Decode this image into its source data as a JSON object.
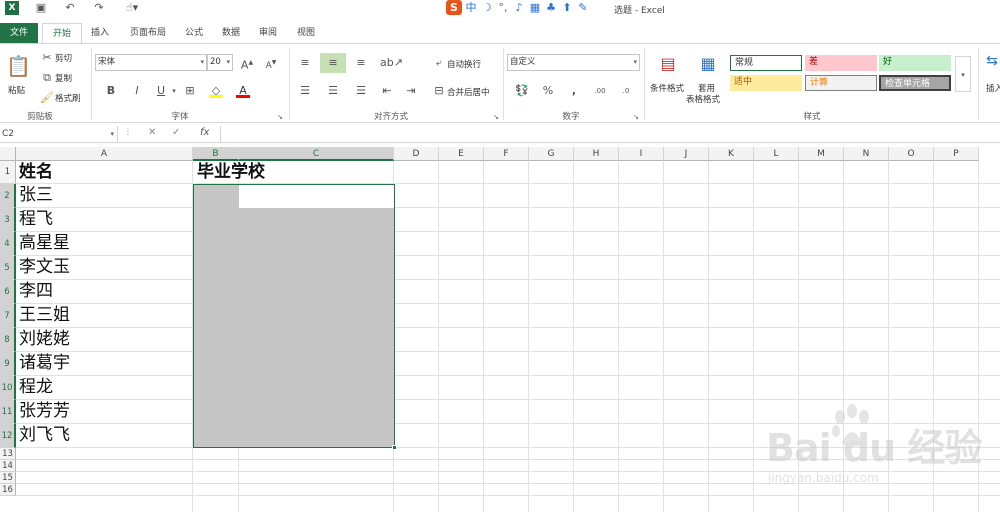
{
  "window": {
    "title": "选题 - Excel"
  },
  "tabs": [
    "文件",
    "开始",
    "插入",
    "页面布局",
    "公式",
    "数据",
    "审阅",
    "视图"
  ],
  "ribbon": {
    "clipboard": {
      "paste": "粘贴",
      "cut": "剪切",
      "copy": "复制",
      "format_painter": "格式刷",
      "label": "剪贴板"
    },
    "font": {
      "name": "宋体",
      "size": "20",
      "bold": "B",
      "italic": "I",
      "underline": "U",
      "label": "字体"
    },
    "alignment": {
      "wrap": "自动换行",
      "merge": "合并后居中",
      "label": "对齐方式"
    },
    "number": {
      "format": "自定义",
      "percent": "%",
      "comma": ",",
      "label": "数字"
    },
    "styles": {
      "conditional": "条件格式",
      "table_line1": "套用",
      "table_line2": "表格格式",
      "cells": [
        {
          "text": "常规",
          "bg": "#ffffff",
          "fg": "#000000"
        },
        {
          "text": "差",
          "bg": "#ffc7ce",
          "fg": "#9c0006"
        },
        {
          "text": "好",
          "bg": "#c6efce",
          "fg": "#006100"
        },
        {
          "text": "适中",
          "bg": "#ffeb9c",
          "fg": "#9c5700"
        },
        {
          "text": "计算",
          "bg": "#f2f2f2",
          "fg": "#fa7d00"
        },
        {
          "text": "检查单元格",
          "bg": "#a5a5a5",
          "fg": "#ffffff"
        }
      ],
      "label": "样式"
    },
    "insert": "插入"
  },
  "formula_bar": {
    "name_box": "C2",
    "fx": "fx",
    "value": ""
  },
  "grid": {
    "columns": [
      "A",
      "B",
      "C",
      "D",
      "E",
      "F",
      "G",
      "H",
      "I",
      "J",
      "K",
      "L",
      "M",
      "N",
      "O",
      "P"
    ],
    "rows": [
      "1",
      "2",
      "3",
      "4",
      "5",
      "6",
      "7",
      "8",
      "9",
      "10",
      "11",
      "12",
      "13",
      "14",
      "15",
      "16"
    ],
    "header_a": "姓名",
    "header_b": "毕业学校",
    "names": [
      "张三",
      "程飞",
      "高星星",
      "李文玉",
      "李四",
      "王三姐",
      "刘姥姥",
      "诸葛宇",
      "程龙",
      "张芳芳",
      "刘飞飞"
    ]
  },
  "watermark": {
    "brand": "Bai du 经验",
    "url": "jingyan.baidu.com"
  },
  "colors": {
    "accent": "#217346",
    "selection": "#c6c6c6"
  }
}
